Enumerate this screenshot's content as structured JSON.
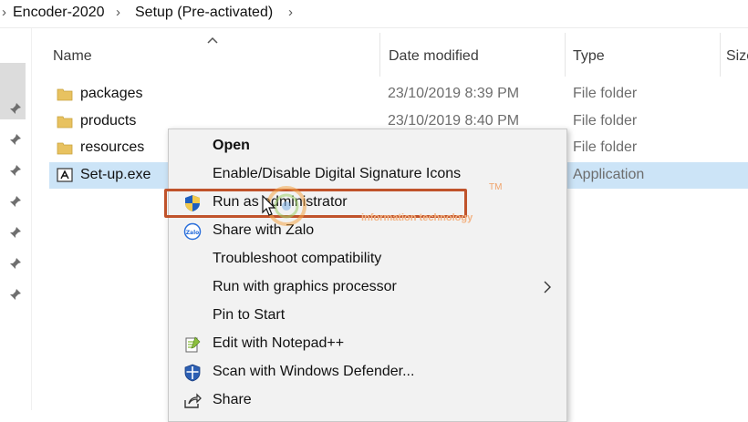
{
  "breadcrumb": {
    "items": [
      "Encoder-2020",
      "Setup (Pre-activated)"
    ],
    "separator": "›"
  },
  "columns": {
    "name": "Name",
    "date_modified": "Date modified",
    "type": "Type",
    "size": "Size"
  },
  "files": [
    {
      "name": "packages",
      "date": "23/10/2019 8:39 PM",
      "type": "File folder",
      "icon": "folder-icon"
    },
    {
      "name": "products",
      "date": "23/10/2019 8:40 PM",
      "type": "File folder",
      "icon": "folder-icon"
    },
    {
      "name": "resources",
      "date": "",
      "type": "File folder",
      "icon": "folder-icon"
    },
    {
      "name": "Set-up.exe",
      "date": "",
      "type": "Application",
      "icon": "adobe-exe-icon",
      "selected": true
    }
  ],
  "context_menu": {
    "items": [
      {
        "label": "Open",
        "bold": true,
        "icon": ""
      },
      {
        "label": "Enable/Disable Digital Signature Icons",
        "icon": ""
      },
      {
        "label": "Run as administrator",
        "icon": "uac-shield-icon",
        "highlighted": true
      },
      {
        "label": "Share with Zalo",
        "icon": "zalo-icon"
      },
      {
        "label": "Troubleshoot compatibility",
        "icon": ""
      },
      {
        "label": "Run with graphics processor",
        "icon": "",
        "submenu": true
      },
      {
        "label": "Pin to Start",
        "icon": ""
      },
      {
        "label": "Edit with Notepad++",
        "icon": "notepadpp-icon"
      },
      {
        "label": "Scan with Windows Defender...",
        "icon": "defender-icon"
      },
      {
        "label": "Share",
        "icon": "share-icon"
      }
    ]
  },
  "watermark": {
    "tm": "TM",
    "text": "information technology"
  },
  "colors": {
    "selection": "#cce4f7",
    "menu_bg": "#f2f2f2",
    "highlight_border": "#c0532b",
    "folder": "#e8c260",
    "text_secondary": "#6d6d6d"
  }
}
